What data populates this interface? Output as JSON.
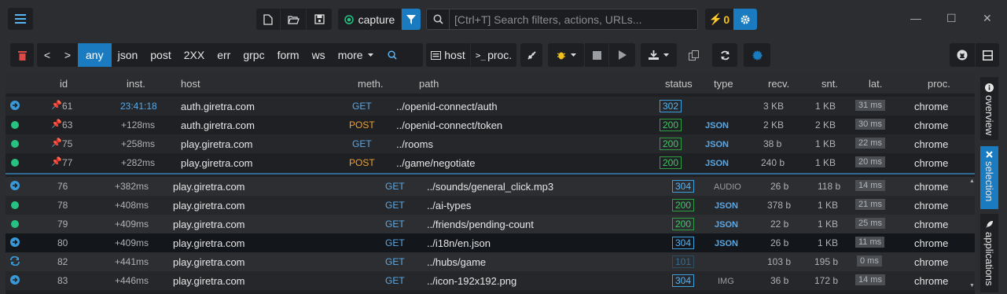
{
  "window": {
    "minimize_glyph": "—",
    "maximize_glyph": "☐",
    "close_glyph": "✕"
  },
  "top": {
    "capture_label": "capture",
    "search_placeholder": "[Ctrl+T] Search filters, actions, URLs...",
    "warning_count": "0",
    "warning_glyph": "⚡"
  },
  "filters": {
    "prev": "<",
    "next": ">",
    "items": [
      "any",
      "json",
      "post",
      "2XX",
      "err",
      "grpc",
      "form",
      "ws",
      "more"
    ],
    "active": "any"
  },
  "actions": {
    "host_label": "host",
    "proc_label": "proc.",
    "proc_prefix": ">_"
  },
  "columns": {
    "id": "id",
    "inst": "inst.",
    "host": "host",
    "meth": "meth.",
    "path": "path",
    "status": "status",
    "type": "type",
    "recv": "recv.",
    "snt": "snt.",
    "lat": "lat.",
    "proc": "proc."
  },
  "pinned_rows": [
    {
      "icon": "arrow",
      "id": "61",
      "inst": "23:41:18",
      "host": "auth.giretra.com",
      "meth": "GET",
      "path": "../openid-connect/auth",
      "status": "302",
      "type": "",
      "recv": "3 KB",
      "snt": "1 KB",
      "lat": "31 ms",
      "proc": "chrome"
    },
    {
      "icon": "dot",
      "id": "63",
      "inst": "+128ms",
      "host": "auth.giretra.com",
      "meth": "POST",
      "path": "../openid-connect/token",
      "status": "200",
      "type": "JSON",
      "recv": "2 KB",
      "snt": "2 KB",
      "lat": "30 ms",
      "proc": "chrome"
    },
    {
      "icon": "dot",
      "id": "75",
      "inst": "+258ms",
      "host": "play.giretra.com",
      "meth": "GET",
      "path": "../rooms",
      "status": "200",
      "type": "JSON",
      "recv": "38 b",
      "snt": "1 KB",
      "lat": "22 ms",
      "proc": "chrome"
    },
    {
      "icon": "dot",
      "id": "77",
      "inst": "+282ms",
      "host": "play.giretra.com",
      "meth": "POST",
      "path": "../game/negotiate",
      "status": "200",
      "type": "JSON",
      "recv": "240 b",
      "snt": "1 KB",
      "lat": "20 ms",
      "proc": "chrome"
    }
  ],
  "rows": [
    {
      "icon": "arrow",
      "id": "76",
      "inst": "+382ms",
      "host": "play.giretra.com",
      "meth": "GET",
      "path": "../sounds/general_click.mp3",
      "status": "304",
      "type": "AUDIO",
      "recv": "26 b",
      "snt": "118 b",
      "lat": "14 ms",
      "proc": "chrome"
    },
    {
      "icon": "dot",
      "id": "78",
      "inst": "+408ms",
      "host": "play.giretra.com",
      "meth": "GET",
      "path": "../ai-types",
      "status": "200",
      "type": "JSON",
      "recv": "378 b",
      "snt": "1 KB",
      "lat": "21 ms",
      "proc": "chrome"
    },
    {
      "icon": "dot",
      "id": "79",
      "inst": "+409ms",
      "host": "play.giretra.com",
      "meth": "GET",
      "path": "../friends/pending-count",
      "status": "200",
      "type": "JSON",
      "recv": "22 b",
      "snt": "1 KB",
      "lat": "25 ms",
      "proc": "chrome"
    },
    {
      "icon": "arrow",
      "id": "80",
      "inst": "+409ms",
      "host": "play.giretra.com",
      "meth": "GET",
      "path": "../i18n/en.json",
      "status": "304",
      "type": "JSON",
      "recv": "26 b",
      "snt": "1 KB",
      "lat": "11 ms",
      "proc": "chrome"
    },
    {
      "icon": "switch",
      "id": "82",
      "inst": "+441ms",
      "host": "play.giretra.com",
      "meth": "GET",
      "path": "../hubs/game",
      "status": "101",
      "type": "",
      "recv": "103 b",
      "snt": "195 b",
      "lat": "0 ms",
      "proc": "chrome"
    },
    {
      "icon": "arrow",
      "id": "83",
      "inst": "+446ms",
      "host": "play.giretra.com",
      "meth": "GET",
      "path": "../icon-192x192.png",
      "status": "304",
      "type": "IMG",
      "recv": "36 b",
      "snt": "172 b",
      "lat": "14 ms",
      "proc": "chrome"
    }
  ],
  "side_tabs": [
    {
      "label": "overview",
      "icon": "info-icon"
    },
    {
      "label": "selection",
      "icon": "close-icon"
    },
    {
      "label": "applications",
      "icon": "rocket-icon"
    }
  ],
  "colors": {
    "accent": "#1a7bc0",
    "ok": "#26c281",
    "warn": "#f0c020",
    "danger": "#e04848"
  }
}
